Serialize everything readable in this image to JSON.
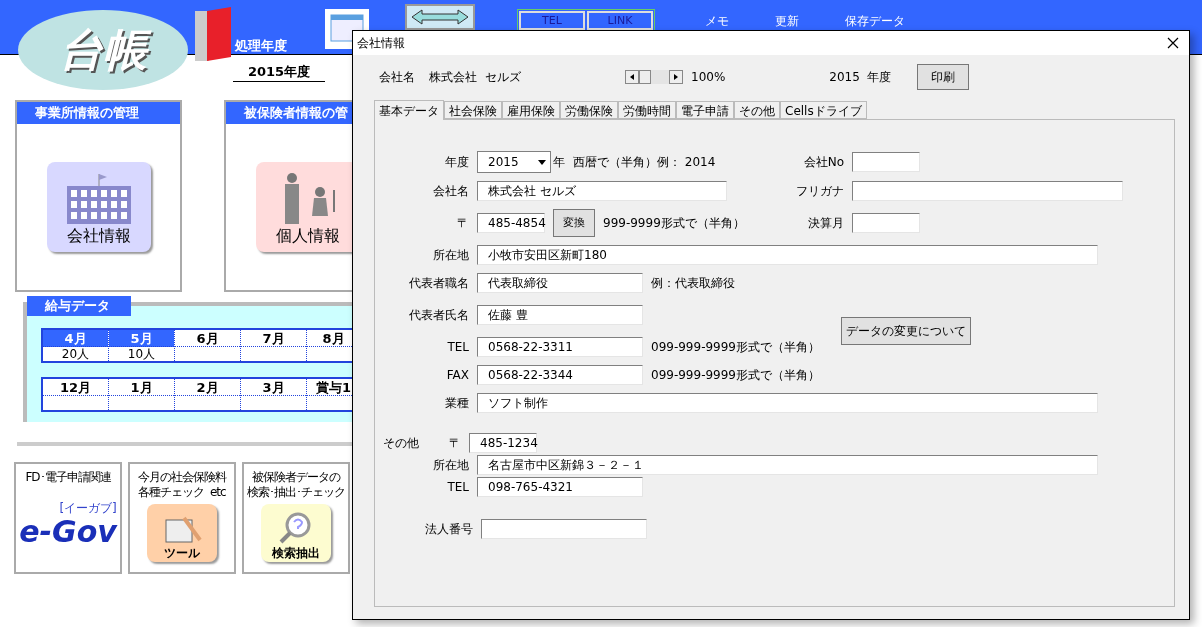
{
  "app": {
    "logo": "台帳",
    "fiscal_label": "処理年度",
    "fiscal_year": "2015年度",
    "header_buttons": [
      "TEL",
      "LINK"
    ],
    "menu": [
      "メモ",
      "更新",
      "保存データ"
    ]
  },
  "sections": [
    {
      "title": "事業所情報の管理",
      "tile": "会社情報",
      "kind": "company"
    },
    {
      "title": "被保険者情報の管",
      "tile": "個人情報",
      "kind": "person"
    }
  ],
  "salary": {
    "title": "給与データ",
    "tables": [
      {
        "months": [
          {
            "label": "4月",
            "value": "20人",
            "highlighted": true
          },
          {
            "label": "5月",
            "value": "10人",
            "highlighted": true
          },
          {
            "label": "6月",
            "highlighted": false
          },
          {
            "label": "7月",
            "highlighted": false
          },
          {
            "label": "8月",
            "highlighted": false
          }
        ]
      },
      {
        "months": [
          {
            "label": "12月",
            "highlighted": false
          },
          {
            "label": "1月",
            "highlighted": false
          },
          {
            "label": "2月",
            "highlighted": false
          },
          {
            "label": "3月",
            "highlighted": false
          },
          {
            "label": "賞与1",
            "highlighted": false
          }
        ]
      }
    ]
  },
  "tools": [
    {
      "kind": "egov",
      "caption": [
        "FD･電子申請関連"
      ],
      "logo": "e-Gov",
      "logo_sub": "[イーガブ]"
    },
    {
      "kind": "tool",
      "caption": [
        "今月の社会保険料",
        "各種チェック  etc"
      ],
      "label": "ツール"
    },
    {
      "kind": "search",
      "caption": [
        "被保険者データの",
        "検索･抽出･チェック"
      ],
      "label": "検索抽出"
    }
  ],
  "dialog": {
    "title": "会社情報",
    "company_label": "会社名",
    "company_name": "株式会社  セルズ",
    "zoom": "100%",
    "year": "2015  年度",
    "print": "印刷",
    "tabs": [
      {
        "label": "基本データ",
        "selected": true
      },
      {
        "label": "社会保険",
        "selected": false
      },
      {
        "label": "雇用保険",
        "selected": false
      },
      {
        "label": "労働保険",
        "selected": false
      },
      {
        "label": "労働時間",
        "selected": false
      },
      {
        "label": "電子申請",
        "selected": false
      },
      {
        "label": "その他",
        "selected": false
      },
      {
        "label": "Cellsドライブ",
        "selected": false
      }
    ],
    "form": {
      "year": {
        "label": "年度",
        "value": "2015",
        "unit": "年",
        "note": "西暦で（半角）例：  2014"
      },
      "company_no": {
        "label": "会社No"
      },
      "company_name": {
        "label": "会社名",
        "value": "株式会社  セルズ"
      },
      "furigana": {
        "label": "フリガナ"
      },
      "postal": {
        "label": "〒",
        "value": "485-4854",
        "button": "変換",
        "note": "999-9999形式で（半角）"
      },
      "closing_month": {
        "label": "決算月"
      },
      "address": {
        "label": "所在地",
        "value": "小牧市安田区新町180"
      },
      "rep_title": {
        "label": "代表者職名",
        "value": "代表取締役",
        "note": "例：代表取締役"
      },
      "rep_name": {
        "label": "代表者氏名",
        "value": "佐藤  豊"
      },
      "change_button": "データの変更について",
      "tel": {
        "label": "TEL",
        "value": "0568-22-3311",
        "note": "099-999-9999形式で（半角）"
      },
      "fax": {
        "label": "FAX",
        "value": "0568-22-3344",
        "note": "099-999-9999形式で（半角）"
      },
      "industry": {
        "label": "業種",
        "value": "ソフト制作"
      },
      "other_label": "その他",
      "other_postal": {
        "label": "〒",
        "value": "485-1234"
      },
      "other_address": {
        "label": "所在地",
        "value": "名古屋市中区新錦３－２－１"
      },
      "other_tel": {
        "label": "TEL",
        "value": "098-765-4321"
      },
      "corporate_number": {
        "label": "法人番号"
      }
    }
  }
}
